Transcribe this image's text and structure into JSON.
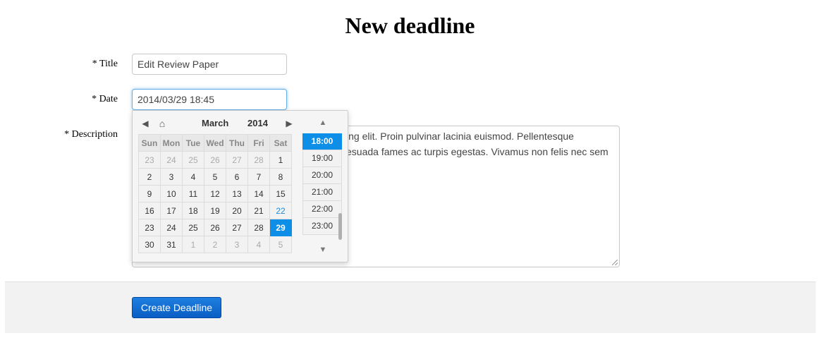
{
  "page": {
    "title": "New deadline"
  },
  "form": {
    "title_label": "* Title",
    "title_value": "Edit Review Paper",
    "date_label": "* Date",
    "date_value": "2014/03/29 18:45",
    "description_label": "* Description",
    "description_visible_line1": "ing elit. Proin pulvinar lacinia euismod. Pellentesque",
    "description_visible_line2": "esuada fames ac turpis egestas. Vivamus non felis nec sem",
    "submit_label": "Create Deadline"
  },
  "datepicker": {
    "month": "March",
    "year": "2014",
    "weekdays": [
      "Sun",
      "Mon",
      "Tue",
      "Wed",
      "Thu",
      "Fri",
      "Sat"
    ],
    "weeks": [
      [
        {
          "d": "23",
          "o": true
        },
        {
          "d": "24",
          "o": true
        },
        {
          "d": "25",
          "o": true
        },
        {
          "d": "26",
          "o": true
        },
        {
          "d": "27",
          "o": true
        },
        {
          "d": "28",
          "o": true
        },
        {
          "d": "1"
        }
      ],
      [
        {
          "d": "2"
        },
        {
          "d": "3"
        },
        {
          "d": "4"
        },
        {
          "d": "5"
        },
        {
          "d": "6"
        },
        {
          "d": "7"
        },
        {
          "d": "8"
        }
      ],
      [
        {
          "d": "9"
        },
        {
          "d": "10"
        },
        {
          "d": "11"
        },
        {
          "d": "12"
        },
        {
          "d": "13"
        },
        {
          "d": "14"
        },
        {
          "d": "15"
        }
      ],
      [
        {
          "d": "16"
        },
        {
          "d": "17"
        },
        {
          "d": "18"
        },
        {
          "d": "19"
        },
        {
          "d": "20"
        },
        {
          "d": "21"
        },
        {
          "d": "22",
          "today": true
        }
      ],
      [
        {
          "d": "23"
        },
        {
          "d": "24"
        },
        {
          "d": "25"
        },
        {
          "d": "26"
        },
        {
          "d": "27"
        },
        {
          "d": "28"
        },
        {
          "d": "29",
          "selected": true
        }
      ],
      [
        {
          "d": "30"
        },
        {
          "d": "31"
        },
        {
          "d": "1",
          "o": true
        },
        {
          "d": "2",
          "o": true
        },
        {
          "d": "3",
          "o": true
        },
        {
          "d": "4",
          "o": true
        },
        {
          "d": "5",
          "o": true
        }
      ]
    ],
    "times": [
      {
        "t": "18:00",
        "active": true
      },
      {
        "t": "19:00"
      },
      {
        "t": "20:00"
      },
      {
        "t": "21:00"
      },
      {
        "t": "22:00"
      },
      {
        "t": "23:00"
      }
    ],
    "colors": {
      "selected": "#0d8fe8",
      "today": "#1a8ee0"
    },
    "icons": {
      "prev": "triangle-left-icon",
      "home": "home-icon",
      "next": "triangle-right-icon",
      "up": "triangle-up-icon",
      "down": "triangle-down-icon"
    }
  }
}
